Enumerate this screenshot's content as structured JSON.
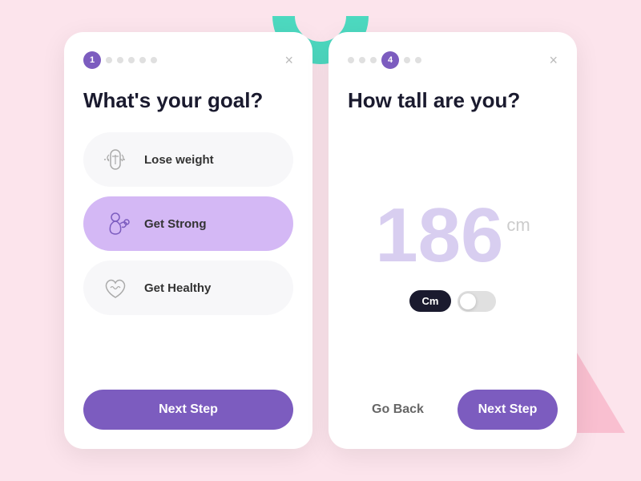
{
  "background": {
    "color": "#f9c6d0"
  },
  "card1": {
    "step": "1",
    "totalDots": 6,
    "activeIndex": 0,
    "title": "What's your goal?",
    "close_label": "×",
    "options": [
      {
        "id": "lose-weight",
        "label": "Lose weight",
        "selected": false
      },
      {
        "id": "get-strong",
        "label": "Get Strong",
        "selected": true
      },
      {
        "id": "get-healthy",
        "label": "Get Healthy",
        "selected": false
      }
    ],
    "next_button": "Next Step"
  },
  "card2": {
    "step": "4",
    "totalDots": 6,
    "activeIndex": 3,
    "title": "How tall are you?",
    "close_label": "×",
    "height_value": "186",
    "height_unit": "cm",
    "unit_label": "Cm",
    "go_back_label": "Go Back",
    "next_button": "Next Step"
  }
}
